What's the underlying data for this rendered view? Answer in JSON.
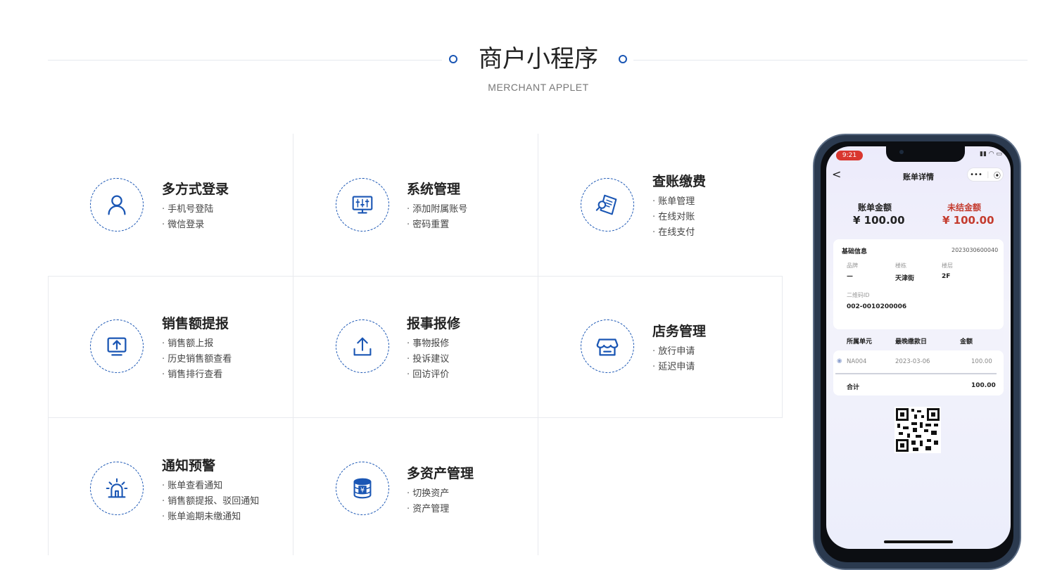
{
  "header": {
    "title": "商户小程序",
    "subtitle": "MERCHANT APPLET"
  },
  "colors": {
    "accent": "#1a56b4",
    "red": "#c43b2e"
  },
  "features": [
    {
      "title": "多方式登录",
      "icon": "user-icon",
      "items": [
        "手机号登陆",
        "微信登录"
      ]
    },
    {
      "title": "系统管理",
      "icon": "monitor-settings-icon",
      "items": [
        "添加附属账号",
        "密码重置"
      ]
    },
    {
      "title": "查账缴费",
      "icon": "bill-search-icon",
      "items": [
        "账单管理",
        "在线对账",
        "在线支付"
      ]
    },
    {
      "title": "销售额提报",
      "icon": "upload-screen-icon",
      "items": [
        "销售额上报",
        "历史销售额查看",
        "销售排行查看"
      ]
    },
    {
      "title": "报事报修",
      "icon": "upload-icon",
      "items": [
        "事物报修",
        "投诉建议",
        "回访评价"
      ]
    },
    {
      "title": "店务管理",
      "icon": "store-icon",
      "items": [
        "放行申请",
        "延迟申请"
      ]
    },
    {
      "title": "通知预警",
      "icon": "alarm-icon",
      "items": [
        "账单查看通知",
        "销售额提报、驳回通知",
        "账单逾期未缴通知"
      ]
    },
    {
      "title": "多资产管理",
      "icon": "asset-coins-icon",
      "items": [
        "切换资产",
        "资产管理"
      ]
    }
  ],
  "phone": {
    "time": "9:21",
    "nav_back": "<",
    "nav_title": "账单详情",
    "capsule_more": "•••",
    "capsule_close": "⦿",
    "bill_amount_label": "账单金额",
    "bill_amount_value": "¥ 100.00",
    "unpaid_label": "未结金额",
    "unpaid_value": "¥ 100.00",
    "basic_info_label": "基础信息",
    "bill_no": "2023030600040",
    "brand_label": "品牌",
    "brand_value": "—",
    "building_label": "楼栋",
    "building_value": "天津街",
    "floor_label": "楼层",
    "floor_value": "2F",
    "qr_id_label": "二维码ID",
    "qr_id_value": "002-0010200006",
    "table_headers": [
      "所属单元",
      "最晚缴款日",
      "金额"
    ],
    "row": {
      "unit": "NA004",
      "date": "2023-03-06",
      "amount": "100.00"
    },
    "total_label": "合计",
    "total_value": "100.00"
  }
}
